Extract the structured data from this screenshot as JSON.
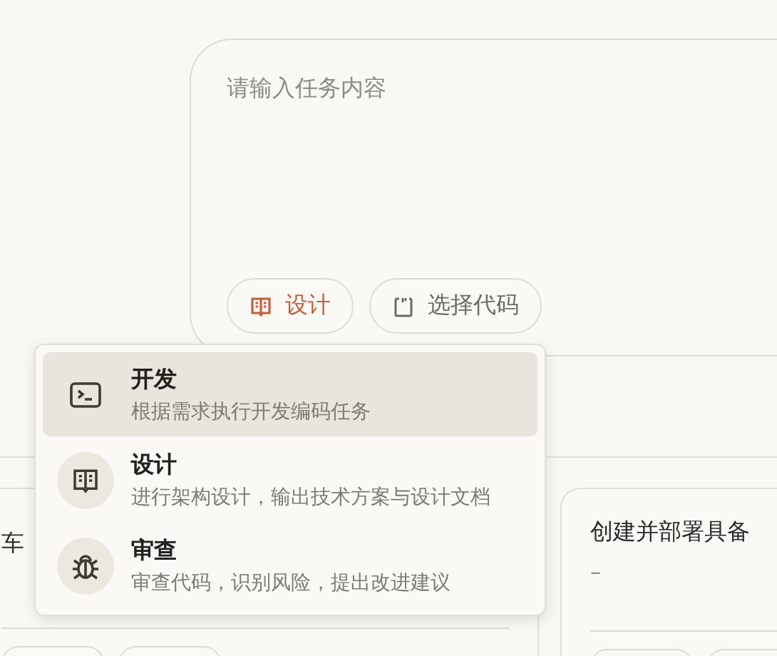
{
  "composer": {
    "placeholder": "请输入任务内容",
    "buttons": [
      {
        "kind": "mode",
        "label": "设计",
        "active": true
      },
      {
        "kind": "code",
        "label": "选择代码",
        "active": false
      }
    ]
  },
  "mode_menu": {
    "items": [
      {
        "kind": "terminal",
        "title": "开发",
        "description": "根据需求执行开发编码任务",
        "selected": true
      },
      {
        "kind": "book",
        "title": "设计",
        "description": "进行架构设计，输出技术方案与设计文档",
        "selected": false
      },
      {
        "kind": "bug",
        "title": "审查",
        "description": "审查代码，识别风险，提出改进建议",
        "selected": false
      }
    ]
  },
  "task_cards": [
    {
      "title": "车"
    },
    {
      "title": "创建并部署具备",
      "subtitle": "–"
    }
  ]
}
